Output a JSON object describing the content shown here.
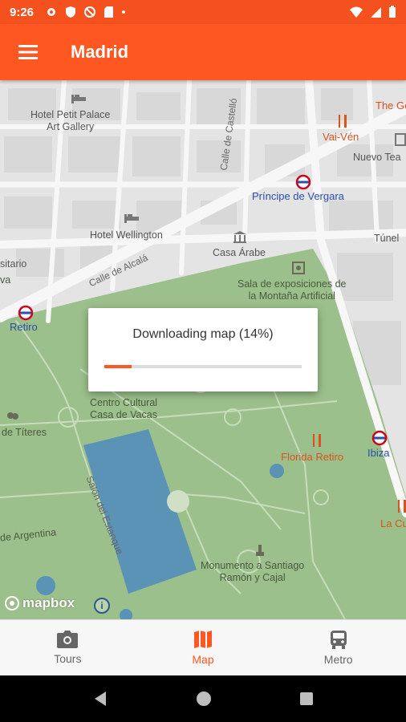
{
  "status_bar": {
    "time": "9:26"
  },
  "app_bar": {
    "title": "Madrid"
  },
  "map": {
    "labels": {
      "hotel_petit": "Hotel Petit Palace\nArt Gallery",
      "hotel_wellington": "Hotel Wellington",
      "calle_castello": "Calle de Castelló",
      "principe_vergara": "Príncipe de Vergara",
      "casa_arabe": "Casa Árabe",
      "calle_alcala": "Calle de Alcalá",
      "sala_exposiciones": "Sala de exposiciones de\nla Montaña Artificial",
      "retiro": "Retiro",
      "centro_cultural": "Centro Cultural\nCasa de Vacas",
      "titeres": "de Títeres",
      "salon_estanque": "Salón del Estanque",
      "florida_retiro": "Florida Retiro",
      "ibiza": "Ibiza",
      "argentina": "de Argentina",
      "monumento": "Monumento a Santiago\nRamón y Cajal",
      "val_ven": "Vai-Vén",
      "nuevo_tea": "Nuevo Tea",
      "the_ge": "The Ge",
      "tunel": "Túnel",
      "sitario": "sitario",
      "va": "va",
      "la_cu": "La Cu"
    },
    "attribution": "mapbox"
  },
  "dialog": {
    "message": "Downloading map (14%)",
    "progress": 0.14
  },
  "bottom_nav": {
    "items": [
      {
        "label": "Tours",
        "icon": "camera-icon"
      },
      {
        "label": "Map",
        "icon": "map-icon"
      },
      {
        "label": "Metro",
        "icon": "bus-icon"
      }
    ],
    "active": "Map"
  },
  "colors": {
    "primary": "#ff5722",
    "status_bar": "#f4511e",
    "park": "#9cc08b",
    "water": "#5a93b5",
    "metro": "#2b4fa8"
  }
}
